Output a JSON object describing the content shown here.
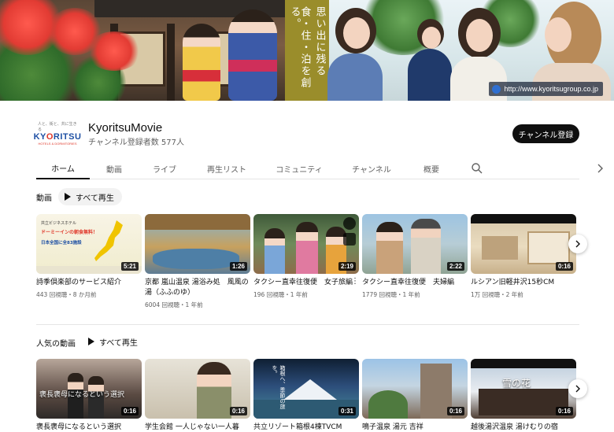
{
  "banner": {
    "slogan_lines": [
      "思い出に残る",
      "食・住・泊を創る。"
    ],
    "url": "http://www.kyoritsugroup.co.jp"
  },
  "channel": {
    "avatar_top": "人と、街と、共に生きる",
    "avatar_logo_a": "KY",
    "avatar_logo_b": "O",
    "avatar_logo_c": "RITSU",
    "avatar_sub": "HOTELS & DORMITORIES",
    "name": "KyoritsuMovie",
    "subscribers": "チャンネル登録者数 577人",
    "subscribe_label": "チャンネル登録"
  },
  "tabs": [
    "ホーム",
    "動画",
    "ライブ",
    "再生リスト",
    "コミュニティ",
    "チャンネル",
    "概要"
  ],
  "sections": [
    {
      "title": "動画",
      "play_all": "すべて再生",
      "videos": [
        {
          "title": "詩季倶楽部のサービス紹介",
          "meta": "443 回視聴・8 か月前",
          "duration": "5:21"
        },
        {
          "title": "京都 嵐山温泉 湯浴み処　風風の湯（ふふのゆ）",
          "meta": "6004 回視聴・1 年前",
          "duration": "1:26"
        },
        {
          "title": "タクシー直幸往復便　女子旅編",
          "meta": "196 回視聴・1 年前",
          "duration": "2:19"
        },
        {
          "title": "タクシー直幸往復便　夫婦編",
          "meta": "1779 回視聴・1 年前",
          "duration": "2:22"
        },
        {
          "title": "ルシアン旧軽井沢15秒CM",
          "meta": "1万 回視聴・2 年前",
          "duration": "0:16"
        }
      ]
    },
    {
      "title": "人気の動画",
      "play_all": "すべて再生",
      "videos": [
        {
          "title": "褒長褒母になるという選択",
          "duration": "0:16"
        },
        {
          "title": "学生会館 一人じゃない一人暮",
          "duration": "0:16"
        },
        {
          "title": "共立リゾート箱根4棟TVCM",
          "duration": "0:31"
        },
        {
          "title": "鳴子温泉 湯元 吉祥",
          "duration": "0:16"
        },
        {
          "title": "越後湯沢温泉 湯けむりの宿",
          "duration": "0:16"
        }
      ]
    }
  ],
  "thumb_text": {
    "t1_line1": "共立ビジネスホテル",
    "t1_line2": "ドーミーインの朝食無料！",
    "t1_line3": "日本全国に全83施設",
    "t6_text": "褒長褒母になるという選択",
    "t8_text": "箱根へ、季節の旅を。",
    "t10_text": "雪の花"
  },
  "colors": {
    "accent": "#0f0f0f",
    "banner_mid": "#9a8d2b",
    "logo_blue": "#1d4fa3",
    "logo_red": "#e0392b"
  },
  "icons": {
    "search": "search-icon",
    "next": "chevron-right-icon",
    "play": "play-icon"
  }
}
